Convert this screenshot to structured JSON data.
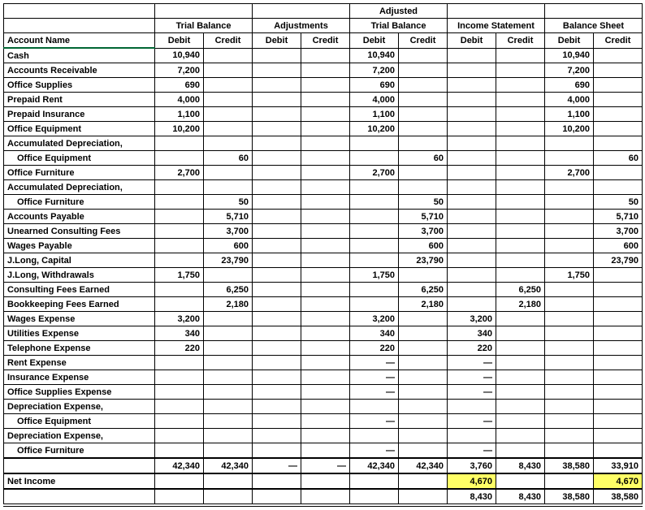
{
  "headers": {
    "super": [
      "",
      "Trial Balance",
      "Adjustments",
      "Adjusted\nTrial Balance",
      "Income Statement",
      "Balance Sheet"
    ],
    "adjusted_top": "Adjusted",
    "adjusted_bot": "Trial Balance",
    "account": "Account Name",
    "dc": [
      "Debit",
      "Credit"
    ]
  },
  "rows": [
    {
      "name": "Cash",
      "tb_d": "10,940",
      "atb_d": "10,940",
      "bs_d": "10,940"
    },
    {
      "name": "Accounts Receivable",
      "tb_d": "7,200",
      "atb_d": "7,200",
      "bs_d": "7,200"
    },
    {
      "name": "Office Supplies",
      "tb_d": "690",
      "atb_d": "690",
      "bs_d": "690"
    },
    {
      "name": "Prepaid Rent",
      "tb_d": "4,000",
      "atb_d": "4,000",
      "bs_d": "4,000"
    },
    {
      "name": "Prepaid Insurance",
      "tb_d": "1,100",
      "atb_d": "1,100",
      "bs_d": "1,100"
    },
    {
      "name": "Office Equipment",
      "tb_d": "10,200",
      "atb_d": "10,200",
      "bs_d": "10,200"
    },
    {
      "name": "Accumulated Depreciation,"
    },
    {
      "name": "   Office Equipment",
      "tb_c": "60",
      "atb_c": "60",
      "bs_c": "60"
    },
    {
      "name": "Office Furniture",
      "tb_d": "2,700",
      "atb_d": "2,700",
      "bs_d": "2,700"
    },
    {
      "name": "Accumulated Depreciation,"
    },
    {
      "name": "   Office Furniture",
      "tb_c": "50",
      "atb_c": "50",
      "bs_c": "50"
    },
    {
      "name": "Accounts Payable",
      "tb_c": "5,710",
      "atb_c": "5,710",
      "bs_c": "5,710"
    },
    {
      "name": "Unearned Consulting Fees",
      "tb_c": "3,700",
      "atb_c": "3,700",
      "bs_c": "3,700"
    },
    {
      "name": "Wages Payable",
      "tb_c": "600",
      "atb_c": "600",
      "bs_c": "600"
    },
    {
      "name": "J.Long, Capital",
      "tb_c": "23,790",
      "atb_c": "23,790",
      "bs_c": "23,790"
    },
    {
      "name": "J.Long, Withdrawals",
      "tb_d": "1,750",
      "atb_d": "1,750",
      "bs_d": "1,750"
    },
    {
      "name": "Consulting Fees Earned",
      "tb_c": "6,250",
      "atb_c": "6,250",
      "is_c": "6,250"
    },
    {
      "name": "Bookkeeping Fees Earned",
      "tb_c": "2,180",
      "atb_c": "2,180",
      "is_c": "2,180"
    },
    {
      "name": "Wages Expense",
      "tb_d": "3,200",
      "atb_d": "3,200",
      "is_d": "3,200"
    },
    {
      "name": "Utilities Expense",
      "tb_d": "340",
      "atb_d": "340",
      "is_d": "340"
    },
    {
      "name": "Telephone Expense",
      "tb_d": "220",
      "atb_d": "220",
      "is_d": "220"
    },
    {
      "name": "Rent Expense",
      "atb_d": "—",
      "is_d": "—"
    },
    {
      "name": "Insurance Expense",
      "atb_d": "—",
      "is_d": "—"
    },
    {
      "name": "Office Supplies Expense",
      "atb_d": "—",
      "is_d": "—"
    },
    {
      "name": "Depreciation Expense,"
    },
    {
      "name": "   Office Equipment",
      "atb_d": "—",
      "is_d": "—"
    },
    {
      "name": "Depreciation Expense,"
    },
    {
      "name": "   Office Furniture",
      "atb_d": "—",
      "is_d": "—"
    }
  ],
  "subtotal": {
    "name": "",
    "tb_d": "42,340",
    "tb_c": "42,340",
    "adj_d": "—",
    "adj_c": "—",
    "atb_d": "42,340",
    "atb_c": "42,340",
    "is_d": "3,760",
    "is_c": "8,430",
    "bs_d": "38,580",
    "bs_c": "33,910"
  },
  "netincome": {
    "name": "Net Income",
    "is_d": "4,670",
    "bs_c": "4,670"
  },
  "final": {
    "is_d": "8,430",
    "is_c": "8,430",
    "bs_d": "38,580",
    "bs_c": "38,580"
  }
}
